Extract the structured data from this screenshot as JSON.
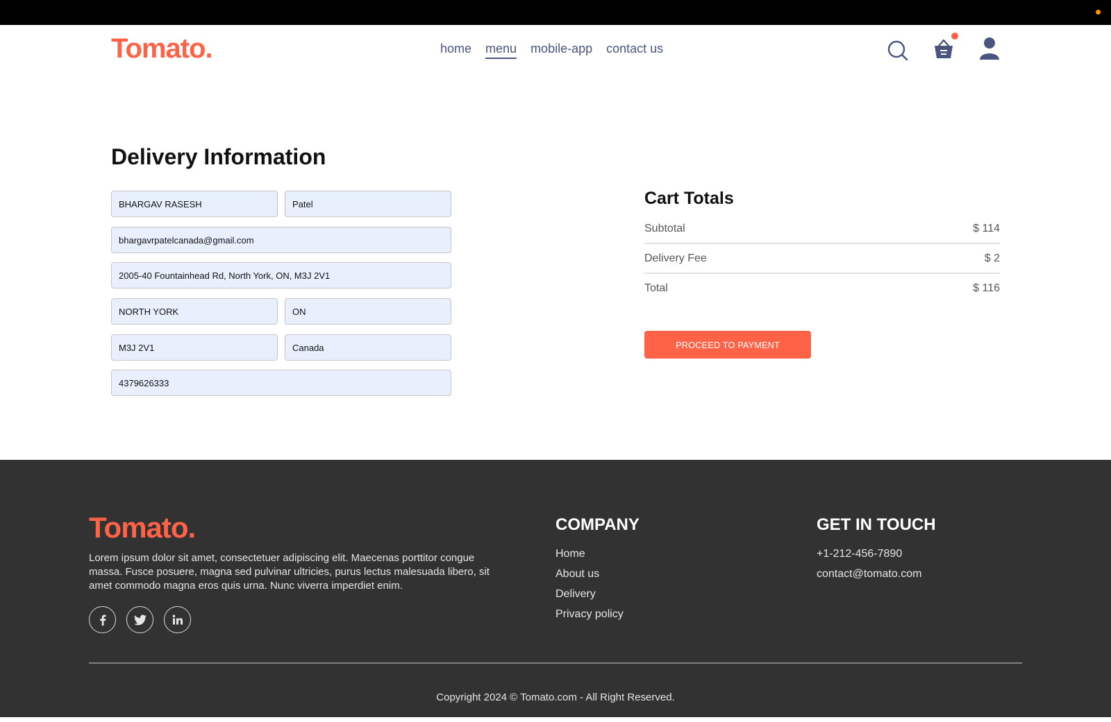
{
  "colors": {
    "brand": "#ff6347",
    "nav_text": "#49557e",
    "field_bg": "#e8f0fe",
    "footer_bg": "#323232",
    "notify_dot": "#ff9500"
  },
  "header": {
    "logo": "Tomato.",
    "nav": [
      "home",
      "menu",
      "mobile-app",
      "contact us"
    ],
    "active_nav": "menu",
    "icons": [
      "search-icon",
      "basket-icon",
      "user-icon"
    ]
  },
  "delivery": {
    "title": "Delivery Information",
    "first_name": "BHARGAV RASESH",
    "last_name": "Patel",
    "email": "bhargavrpatelcanada@gmail.com",
    "street": "2005-40 Fountainhead Rd, North York, ON, M3J 2V1",
    "city": "NORTH YORK",
    "state": "ON",
    "zip": "M3J 2V1",
    "country": "Canada",
    "phone": "4379626333"
  },
  "cart_totals": {
    "title": "Cart Totals",
    "subtotal_label": "Subtotal",
    "subtotal_value": "$ 114",
    "delivery_label": "Delivery Fee",
    "delivery_value": "$ 2",
    "total_label": "Total",
    "total_value": "$ 116",
    "button": "PROCEED TO PAYMENT"
  },
  "footer": {
    "logo": "Tomato.",
    "description": "Lorem ipsum dolor sit amet, consectetuer adipiscing elit. Maecenas porttitor congue massa. Fusce posuere, magna sed pulvinar ultricies, purus lectus malesuada libero, sit amet commodo magna eros quis urna. Nunc viverra imperdiet enim.",
    "socials": [
      "facebook-icon",
      "twitter-icon",
      "linkedin-icon"
    ],
    "company": {
      "heading": "COMPANY",
      "links": [
        "Home",
        "About us",
        "Delivery",
        "Privacy policy"
      ]
    },
    "contact": {
      "heading": "GET IN TOUCH",
      "phone": "+1-212-456-7890",
      "email": "contact@tomato.com"
    },
    "copyright": "Copyright 2024 © Tomato.com - All Right Reserved."
  }
}
